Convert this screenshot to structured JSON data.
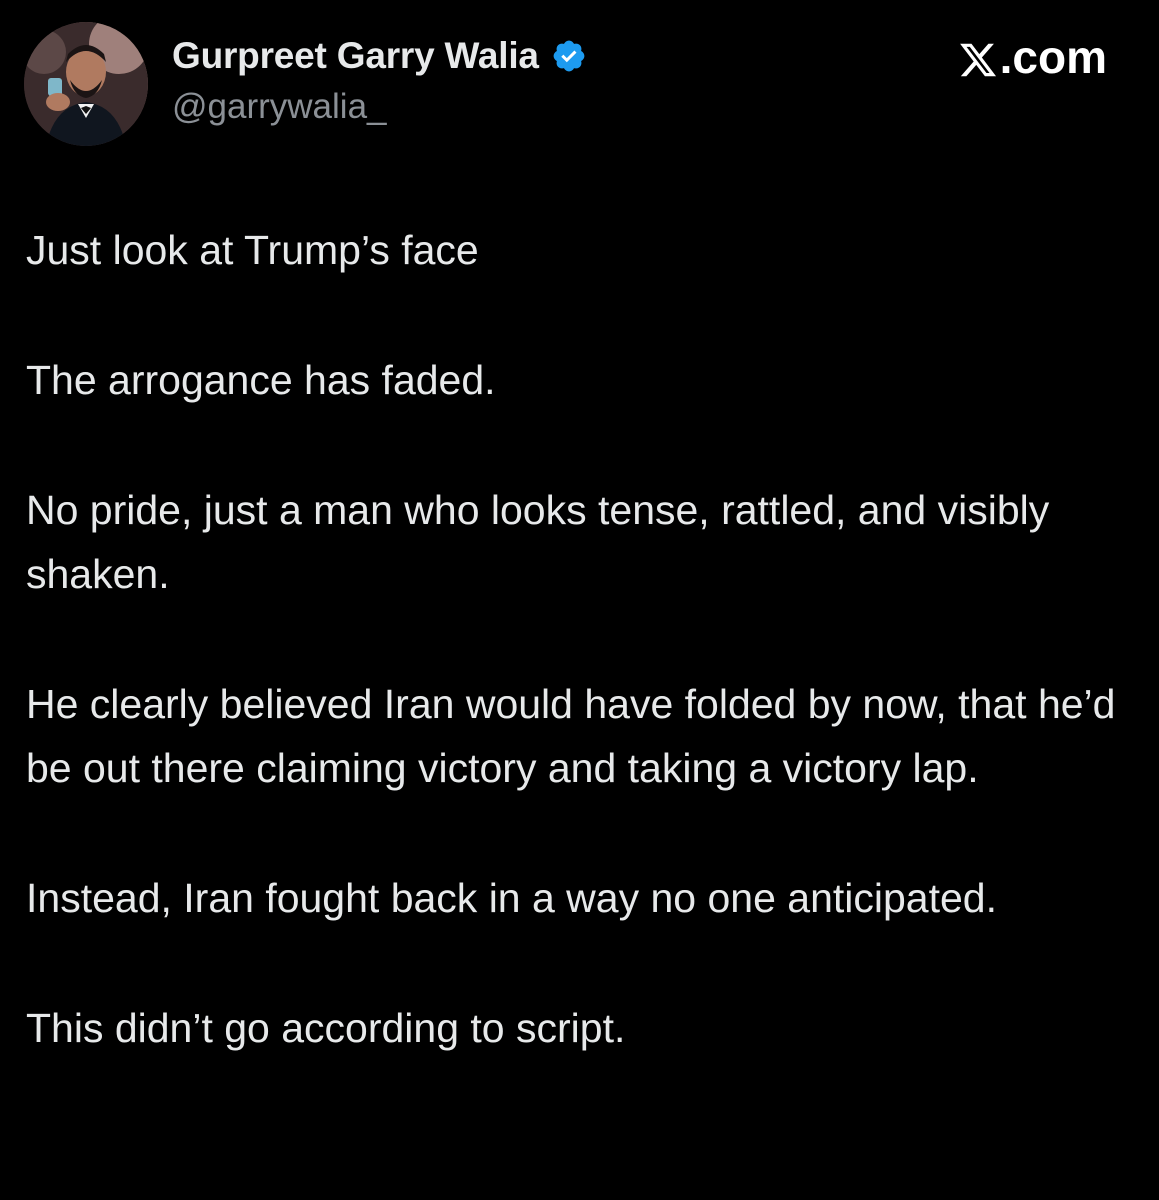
{
  "author": {
    "display_name": "Gurpreet Garry Walia",
    "handle": "@garrywalia_",
    "verified": true,
    "verified_color": "#1d9bf0"
  },
  "brand": {
    "domain_suffix": ".com",
    "logo_icon": "x-logo-icon"
  },
  "tweet": {
    "paragraphs": [
      "Just look at Trump’s face",
      "The arrogance has faded.",
      "No pride,  just a man who looks tense, rattled, and visibly shaken.",
      "He clearly believed Iran would have folded by now, that he’d be out there claiming victory and taking a victory lap.",
      "Instead, Iran fought back in a way no one anticipated.",
      "This didn’t go according to script."
    ]
  },
  "colors": {
    "background": "#000000",
    "text": "#e7e9ea",
    "secondary_text": "#8b9096"
  }
}
